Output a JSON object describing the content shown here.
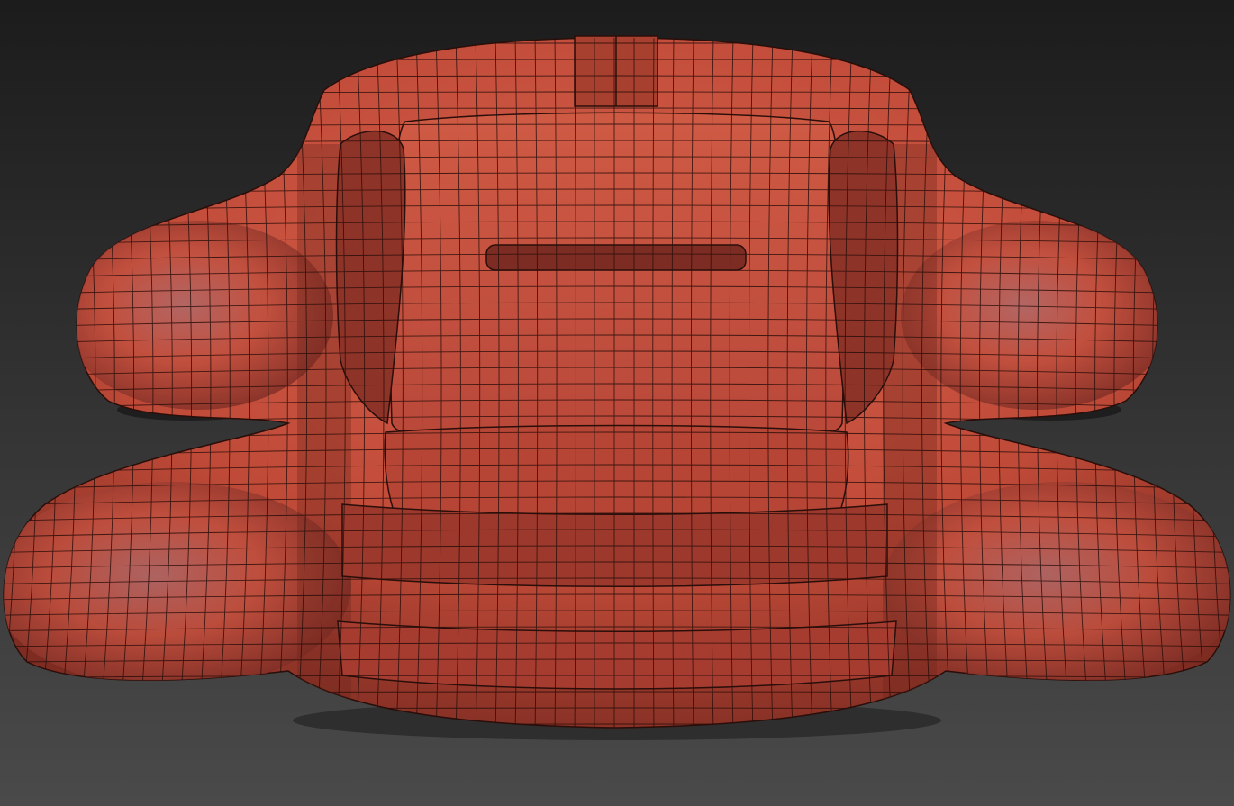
{
  "viewport": {
    "background_top": "#1c1c1c",
    "background_bottom": "#4a4a4a",
    "model": {
      "subject": "car-body-mesh",
      "view": "top",
      "shading": "smooth-with-wireframe",
      "surface_color": "#c8503c",
      "surface_shadow": "#7a2a22",
      "surface_highlight": "#d98f8a",
      "wire_color": "#2a0e0a"
    }
  }
}
